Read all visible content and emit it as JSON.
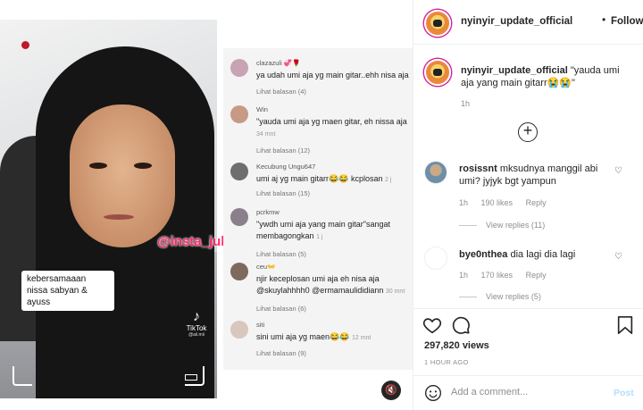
{
  "media": {
    "video_caption": "kebersamaaan nissa sabyan & ayuss",
    "tiktok_label": "TikTok",
    "tiktok_handle": "@aii.mii",
    "watermark": "@insta_julid",
    "comments": [
      {
        "user": "clazazuli 💞🌹",
        "text": "ya udah umi aja yg main gitar..ehh nisa aja",
        "meta": "",
        "reply": "Lihat balasan (4)"
      },
      {
        "user": "Win",
        "text": "\"yauda umi aja yg maen gitar, eh nissa aja",
        "meta": "34 mnt",
        "reply": "Lihat balasan (12)"
      },
      {
        "user": "Kecubung Ungu647",
        "text": "umi aj yg main gitarr😂😂 kcplosan",
        "meta": "2 j",
        "reply": "Lihat balasan (15)"
      },
      {
        "user": "pcrkmw",
        "text": "\"ywdh umi aja yang main gitar\"sangat membagongkan",
        "meta": "1 j",
        "reply": "Lihat balasan (5)"
      },
      {
        "user": "ceu👐",
        "text": "njir keceplosan umi aja eh nisa aja @skuylahhhh0 @ermamaulididiann",
        "meta": "30 mnt",
        "reply": "Lihat balasan (6)"
      },
      {
        "user": "siti",
        "text": "sini umi aja yg maen😂😂",
        "meta": "12 mnt",
        "reply": "Lihat balasan (9)"
      }
    ]
  },
  "header": {
    "username": "nyinyir_update_official",
    "separator": "•",
    "follow_label": "Following"
  },
  "caption": {
    "username": "nyinyir_update_official",
    "text": "\"yauda umi aja yang main gitarr😭😭\"",
    "time": "1h"
  },
  "load_more_label": "+",
  "post_comments": [
    {
      "username": "rosissnt",
      "text": "mksudnya manggil abi umi? jyjyk bgt yampun",
      "time": "1h",
      "likes": "190 likes",
      "reply": "Reply",
      "view_replies": "View replies (11)"
    },
    {
      "username": "bye0nthea",
      "text": "dia lagi dia lagi",
      "time": "1h",
      "likes": "170 likes",
      "reply": "Reply",
      "view_replies": "View replies (5)"
    }
  ],
  "stats": {
    "views": "297,820 views",
    "ago": "1 HOUR AGO"
  },
  "add_comment": {
    "placeholder": "Add a comment...",
    "post_label": "Post"
  },
  "colors": {
    "accent": "#0095f6",
    "post_disabled": "#b2dffc",
    "watermark": "#ff2a6a"
  }
}
